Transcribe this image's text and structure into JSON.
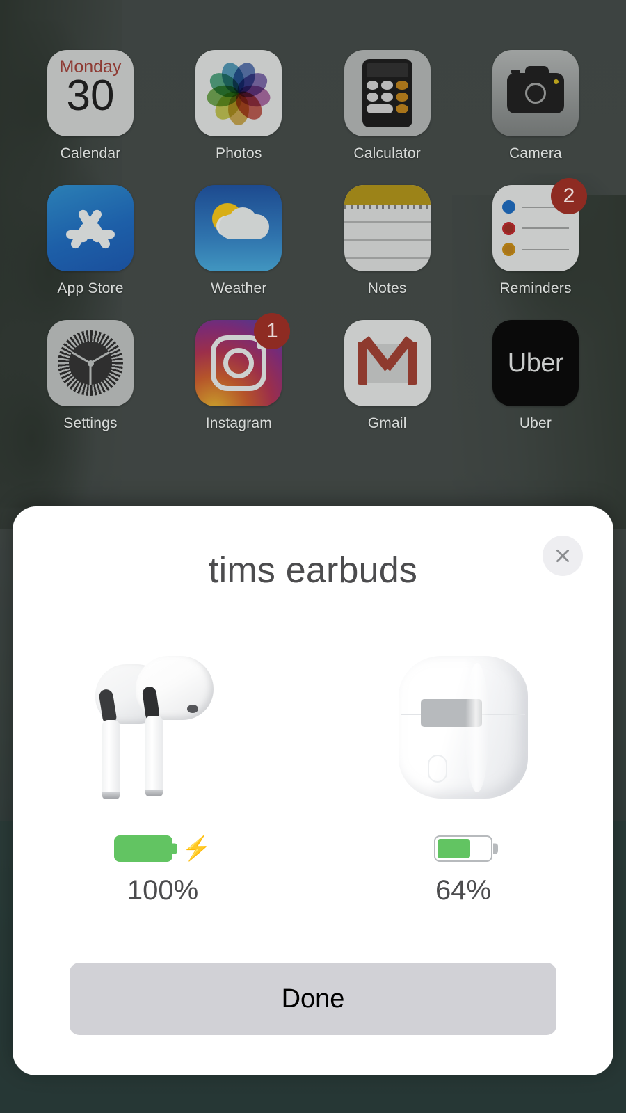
{
  "wallpaper": {
    "description": "limestone-cliff-lagoon",
    "sky_color": "#3f4643",
    "water_color": "#133330",
    "foliage_color": "#152014"
  },
  "home_screen": {
    "rows": [
      [
        {
          "label": "Calendar",
          "icon": "calendar-icon",
          "badge": null,
          "calendar": {
            "weekday": "Monday",
            "day": "30"
          }
        },
        {
          "label": "Photos",
          "icon": "photos-icon",
          "badge": null
        },
        {
          "label": "Calculator",
          "icon": "calculator-icon",
          "badge": null
        },
        {
          "label": "Camera",
          "icon": "camera-icon",
          "badge": null
        }
      ],
      [
        {
          "label": "App Store",
          "icon": "app-store-icon",
          "badge": null
        },
        {
          "label": "Weather",
          "icon": "weather-icon",
          "badge": null
        },
        {
          "label": "Notes",
          "icon": "notes-icon",
          "badge": null
        },
        {
          "label": "Reminders",
          "icon": "reminders-icon",
          "badge": "2"
        }
      ],
      [
        {
          "label": "Settings",
          "icon": "settings-icon",
          "badge": null
        },
        {
          "label": "Instagram",
          "icon": "instagram-icon",
          "badge": "1"
        },
        {
          "label": "Gmail",
          "icon": "gmail-icon",
          "badge": null
        },
        {
          "label": "Uber",
          "icon": "uber-icon",
          "badge": null,
          "wordmark": "Uber"
        }
      ]
    ],
    "partial_row_colors": [
      "#9ea1a0",
      "#2fa72f",
      "#a8abaa",
      "#b0b3b2"
    ],
    "badge_color": "#8e2b22"
  },
  "sheet": {
    "title": "tims earbuds",
    "close_icon": "close-icon",
    "devices": [
      {
        "name": "earbuds",
        "art": "airpods-pro-icon",
        "battery_percent": 100,
        "battery_label": "100%",
        "charging": true,
        "charging_icon": "lightning-bolt-icon",
        "style": "full"
      },
      {
        "name": "charging-case",
        "art": "airpods-case-icon",
        "battery_percent": 64,
        "battery_label": "64%",
        "charging": false,
        "style": "outline"
      }
    ],
    "done_label": "Done",
    "colors": {
      "battery_green": "#62c462",
      "battery_outline": "#b7babd",
      "done_background": "#d1d1d6",
      "title_text": "#4c4c4e"
    }
  }
}
